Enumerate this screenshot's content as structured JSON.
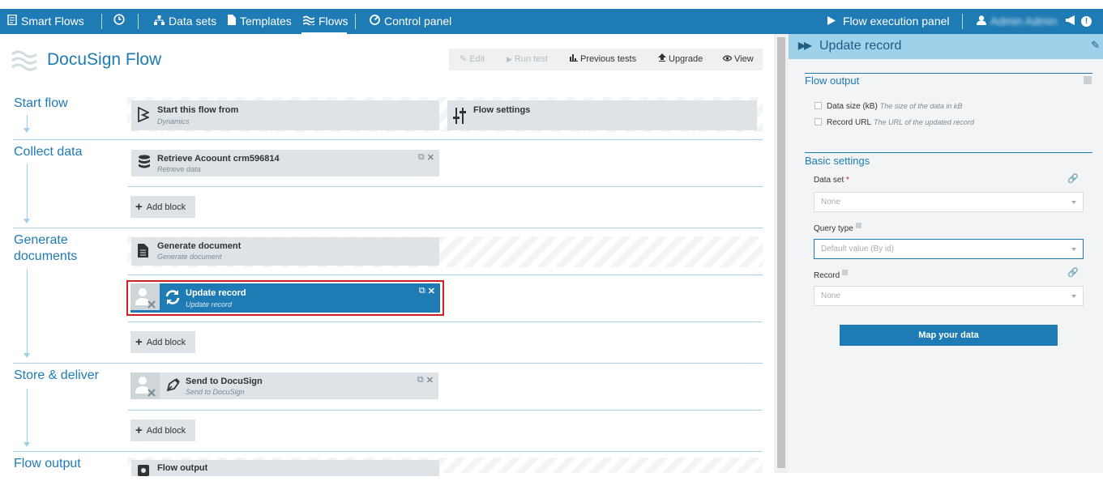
{
  "nav": {
    "app": "Smart Flows",
    "datasets": "Data sets",
    "templates": "Templates",
    "flows": "Flows",
    "control_panel": "Control panel",
    "execution_panel": "Flow execution panel",
    "user": "Admin Admin",
    "notification_count": "!"
  },
  "page": {
    "title": "DocuSign Flow",
    "actions": {
      "edit": "Edit",
      "run_test": "Run test",
      "previous_tests": "Previous tests",
      "upgrade": "Upgrade",
      "view": "View"
    }
  },
  "sections": {
    "start": {
      "label": "Start flow",
      "start_block": {
        "title": "Start this flow from",
        "subtitle": "Dynamics"
      },
      "settings_block": {
        "title": "Flow settings"
      }
    },
    "collect": {
      "label": "Collect data",
      "block": {
        "title": "Retrieve Acoount crm596814",
        "subtitle": "Retrieve data"
      },
      "add": "Add block"
    },
    "generate": {
      "label": "Generate documents",
      "block": {
        "title": "Generate document",
        "subtitle": "Generate document"
      },
      "selected_block": {
        "title": "Update record",
        "subtitle": "Update record"
      },
      "add": "Add block"
    },
    "store": {
      "label": "Store & deliver",
      "block": {
        "title": "Send to DocuSign",
        "subtitle": "Send to DocuSign"
      },
      "add": "Add block"
    },
    "output": {
      "label": "Flow output",
      "block": {
        "title": "Flow output"
      }
    }
  },
  "panel": {
    "title": "Update record",
    "flow_output": {
      "heading": "Flow output",
      "items": [
        {
          "label": "Data size (kB)",
          "hint": "The size of the data in kB"
        },
        {
          "label": "Record URL",
          "hint": "The URL of the updated record"
        }
      ]
    },
    "basic": {
      "heading": "Basic settings",
      "dataset_label": "Data set",
      "dataset_required": "*",
      "dataset_value": "None",
      "query_label": "Query type",
      "query_value": "Default value (By id)",
      "record_label": "Record",
      "record_value": "None",
      "map_button": "Map your data"
    }
  }
}
